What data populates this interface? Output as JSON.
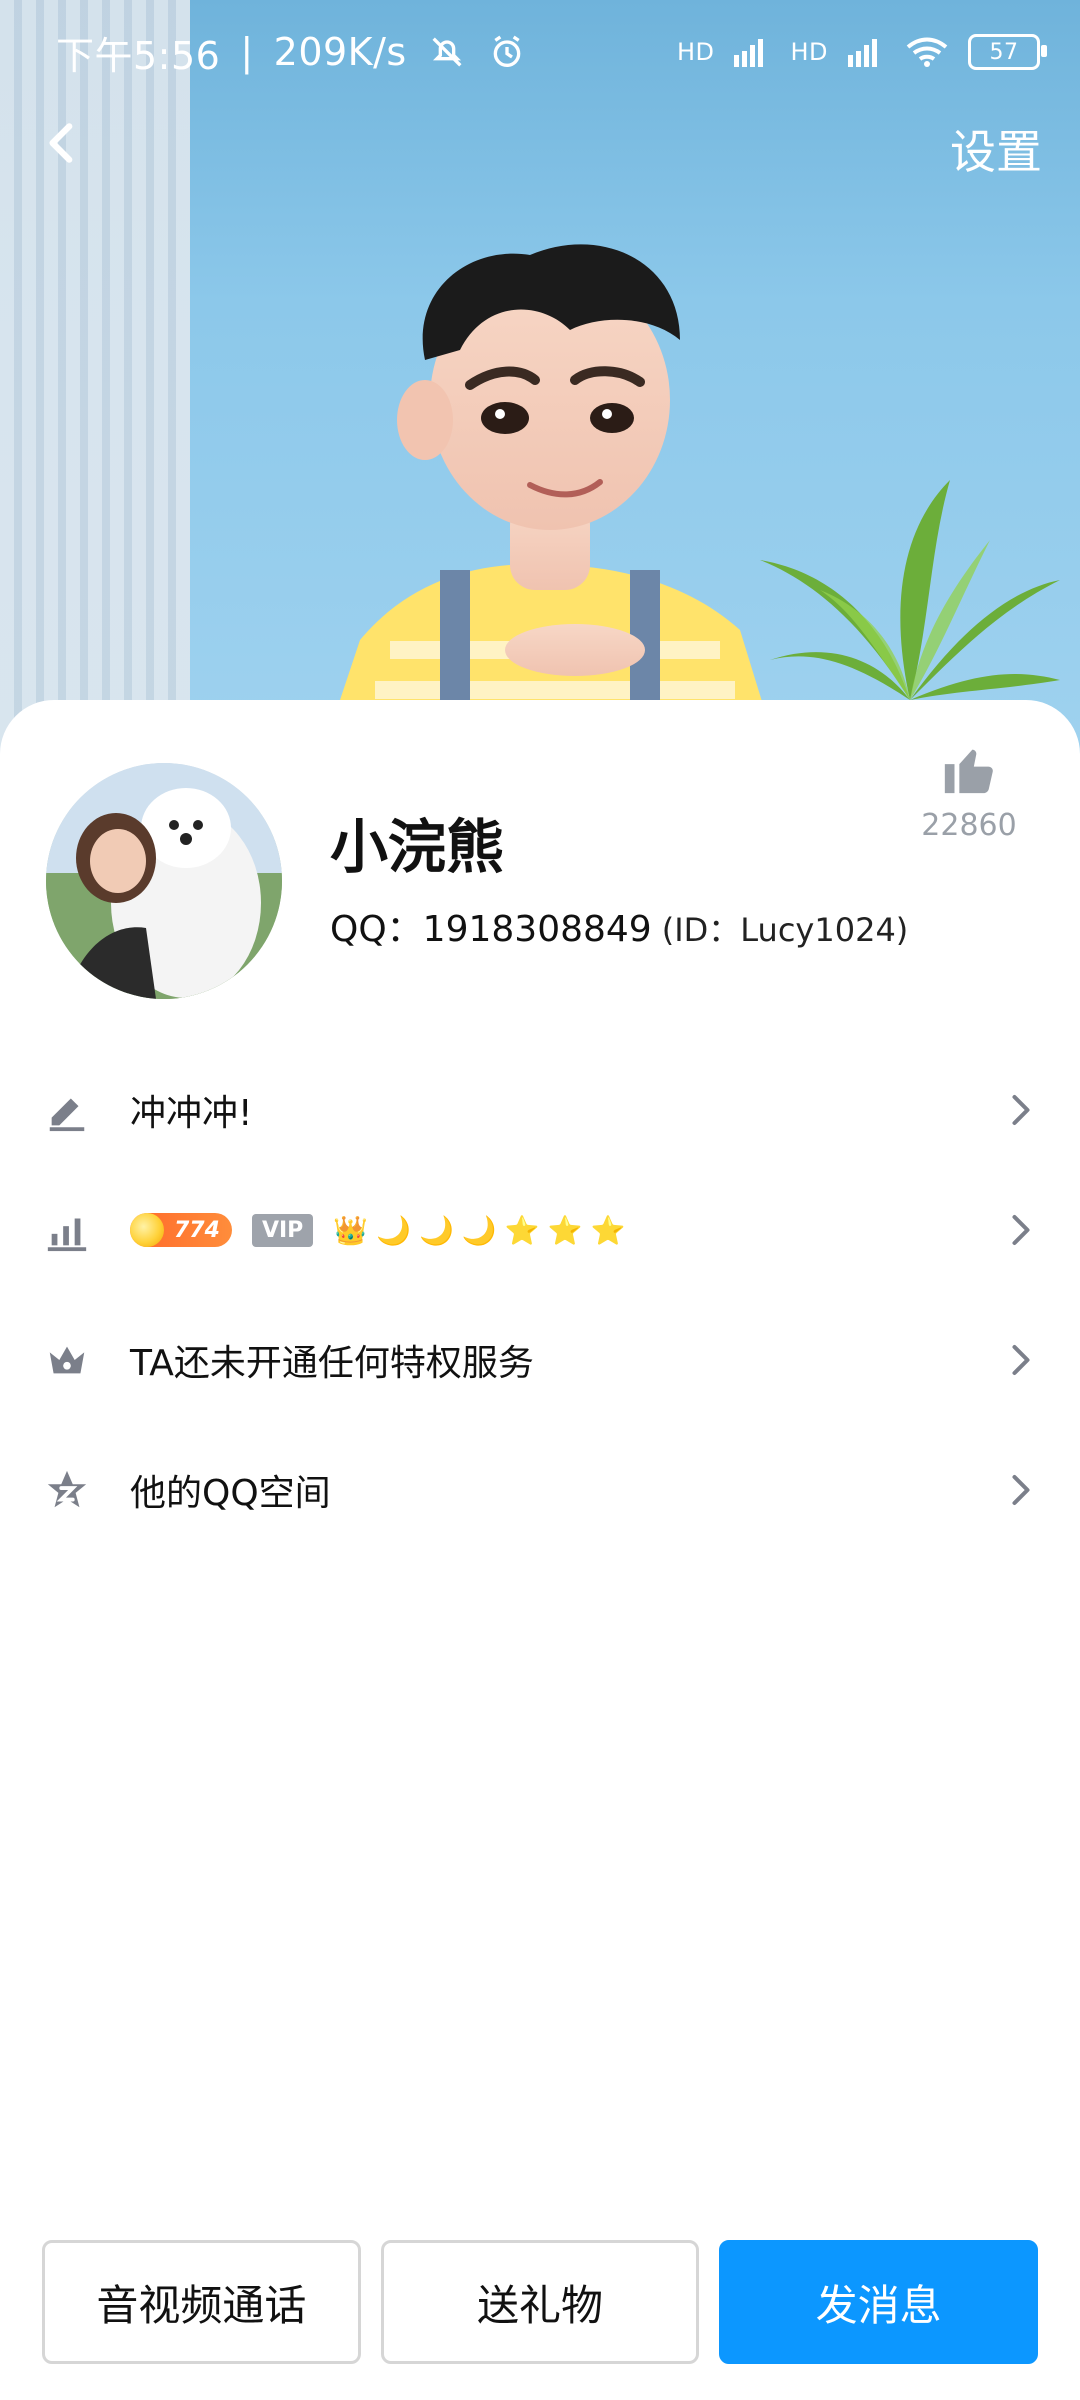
{
  "status_bar": {
    "time": "下午5:56",
    "network_speed": "209K/s",
    "battery": "57",
    "signal_1": "HD",
    "signal_2": "HD",
    "icons": [
      "mute-bell-icon",
      "alarm-icon",
      "signal-icon",
      "signal-icon",
      "wifi-icon",
      "battery-icon"
    ]
  },
  "header": {
    "settings_label": "设置",
    "back_icon": "back-chevron-icon"
  },
  "profile": {
    "name": "小浣熊",
    "qq_label": "QQ：1918308849",
    "id_label": "(ID：Lucy1024)",
    "likes": "22860"
  },
  "list": {
    "signature": "冲冲冲!",
    "level_number": "774",
    "vip_label": "VIP",
    "level_icons": [
      "crown",
      "moon",
      "moon",
      "moon",
      "star",
      "star",
      "star"
    ],
    "privilege_text": "TA还未开通任何特权服务",
    "qzone_text": "他的QQ空间"
  },
  "actions": {
    "call": "音视频通话",
    "gift": "送礼物",
    "message": "发消息"
  }
}
